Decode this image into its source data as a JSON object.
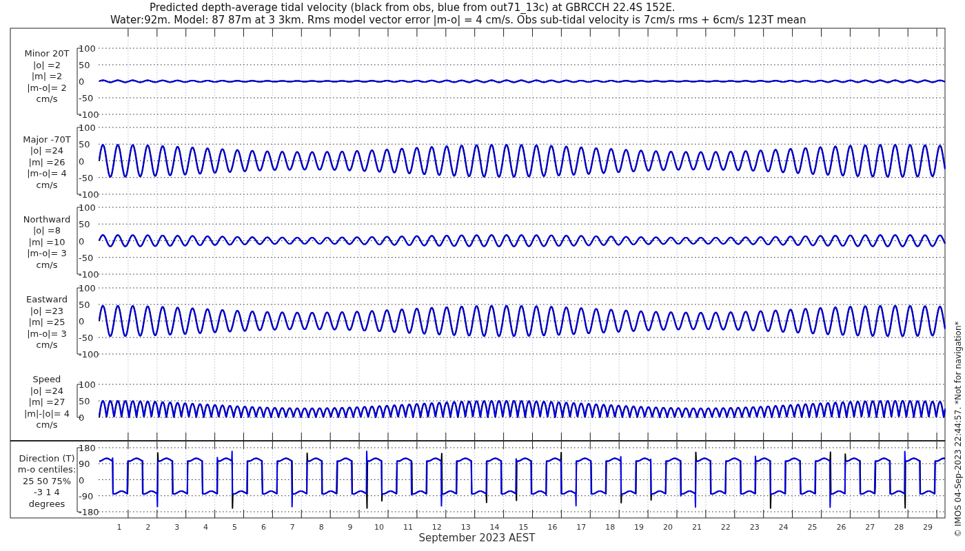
{
  "title_lines": [
    "Predicted depth-average tidal velocity (black from obs, blue from out71_13c) at GBRCCH 22.4S 152E.",
    "Water:92m. Model: 87 87m at 3 3km. Rms model vector error |m-o| = 4 cm/s. Obs sub-tidal velocity is 7cm/s rms + 6cm/s 123T mean"
  ],
  "panels": [
    {
      "kind": "minor",
      "label_lines": [
        "Minor 20T",
        "|o| =2",
        "|m| =2",
        "|m-o|= 2",
        "cm/s"
      ],
      "yticks": [
        "100",
        "50",
        "0",
        "-50",
        "-100"
      ]
    },
    {
      "kind": "major",
      "label_lines": [
        "Major -70T",
        "|o| =24",
        "|m| =26",
        "|m-o|= 4",
        "cm/s"
      ],
      "yticks": [
        "100",
        "50",
        "0",
        "-50",
        "-100"
      ]
    },
    {
      "kind": "north",
      "label_lines": [
        "Northward",
        "|o| =8",
        "|m| =10",
        "|m-o|= 3",
        "cm/s"
      ],
      "yticks": [
        "100",
        "50",
        "0",
        "-50",
        "-100"
      ]
    },
    {
      "kind": "east",
      "label_lines": [
        "Eastward",
        "|o| =23",
        "|m| =25",
        "|m-o|= 3",
        "cm/s"
      ],
      "yticks": [
        "100",
        "50",
        "0",
        "-50",
        "-100"
      ]
    },
    {
      "kind": "speed",
      "label_lines": [
        "Speed",
        "|o| =24",
        "|m| =27",
        "|m|-|o|= 4",
        "cm/s"
      ],
      "yticks": [
        "100",
        "50",
        "0"
      ]
    },
    {
      "kind": "direction",
      "label_lines": [
        "Direction (T)",
        "m-o centiles:",
        "25  50  75%",
        "-3  1  4",
        "degrees"
      ],
      "yticks": [
        "180",
        "90",
        "0",
        "-90",
        "-180"
      ]
    }
  ],
  "x_axis": {
    "day_labels": [
      "1",
      "2",
      "3",
      "4",
      "5",
      "6",
      "7",
      "8",
      "9",
      "10",
      "11",
      "12",
      "13",
      "14",
      "15",
      "16",
      "17",
      "18",
      "19",
      "20",
      "21",
      "22",
      "23",
      "24",
      "25",
      "26",
      "27",
      "28",
      "29"
    ],
    "xlabel": "September 2023 AEST"
  },
  "side_note": "© IMOS 04-Sep-2023 22:44:57. *Not for navigation*"
}
